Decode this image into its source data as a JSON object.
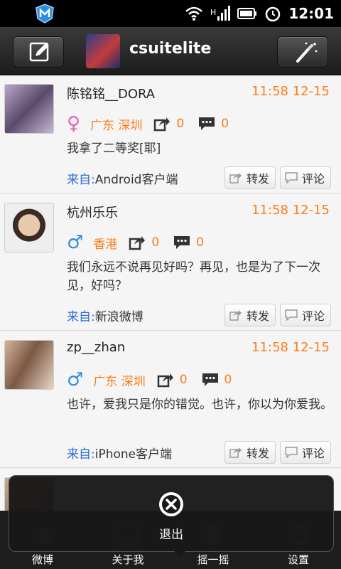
{
  "status_bar": {
    "time": "12:01",
    "icons": [
      "app-m-icon",
      "wifi-icon",
      "signal-icon",
      "battery-icon",
      "alarm-icon"
    ]
  },
  "header": {
    "username": "csuitelite",
    "left_icon": "compose-icon",
    "right_icon": "magic-wand-icon"
  },
  "feed": [
    {
      "name": "陈铭铭__DORA",
      "time": "11:58 12-15",
      "gender": "♀",
      "gender_color": "#e85fb0",
      "location": "广东 深圳",
      "reposts": "0",
      "comments": "0",
      "text": "我拿了二等奖[耶]",
      "source_label": "来自:",
      "source": "Android客户端",
      "forward_label": "转发",
      "comment_label": "评论"
    },
    {
      "name": "杭州乐乐",
      "time": "11:58 12-15",
      "gender": "♂",
      "gender_color": "#2d8de0",
      "location": "香港",
      "reposts": "0",
      "comments": "0",
      "text": "我们永远不说再见好吗？再见，也是为了下一次见，好吗？",
      "source_label": "来自:",
      "source": "新浪微博",
      "forward_label": "转发",
      "comment_label": "评论"
    },
    {
      "name": "zp__zhan",
      "time": "11:58 12-15",
      "gender": "♂",
      "gender_color": "#2d8de0",
      "location": "广东 深圳",
      "reposts": "0",
      "comments": "0",
      "text": "也许，爱我只是你的错觉。也许，你以为你爱我。",
      "source_label": "来自:",
      "source": "iPhone客户端",
      "forward_label": "转发",
      "comment_label": "评论"
    }
  ],
  "popup": {
    "exit_label": "退出"
  },
  "tabs": [
    {
      "label": "微博"
    },
    {
      "label": "关于我"
    },
    {
      "label": "摇一摇"
    },
    {
      "label": "设置"
    }
  ],
  "colors": {
    "accent_orange": "#ff7a1a",
    "source_blue": "#2f6fd1"
  }
}
